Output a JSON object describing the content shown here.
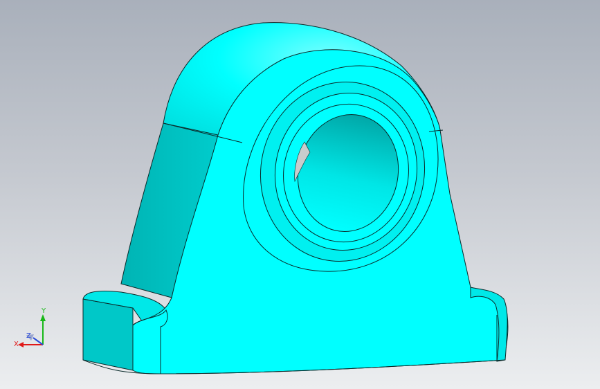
{
  "viewport": {
    "background_top": "#a9b0bb",
    "background_bottom": "#eceef0"
  },
  "model": {
    "part": "pillow-block-bearing-housing",
    "face_color": "#00ffff",
    "shade_color": "#00c8c8",
    "edge_color": "#0a2a2a"
  },
  "triad": {
    "x_label": "X",
    "y_label": "Y",
    "z_label": "Z",
    "x_color": "#e01818",
    "y_color": "#18b818",
    "z_color": "#2a4ad8"
  }
}
